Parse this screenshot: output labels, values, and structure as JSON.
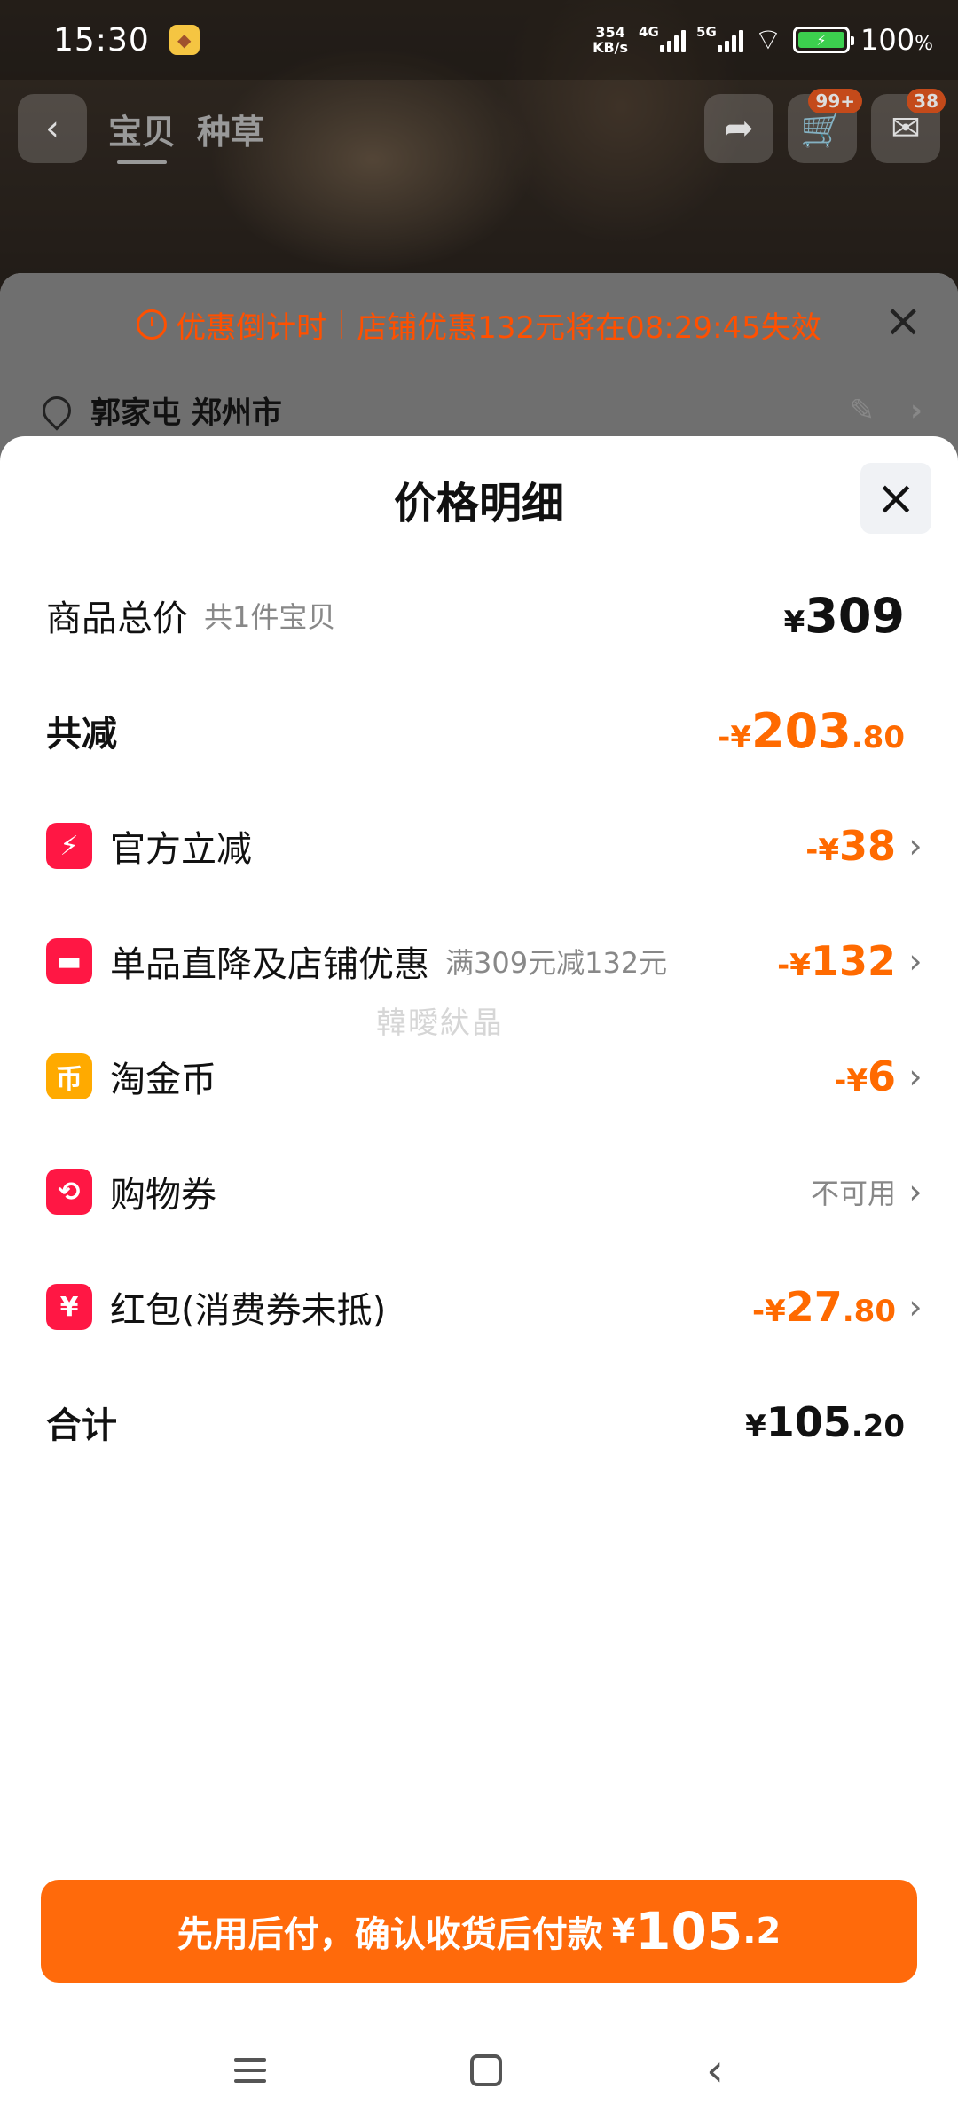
{
  "status_bar": {
    "time": "15:30",
    "net_speed_value": "354",
    "net_speed_unit": "KB/s",
    "signal_1_label": "4G",
    "signal_2_label": "5G",
    "battery_percent": "100",
    "battery_unit": "%"
  },
  "top_nav": {
    "tab_1": "宝贝",
    "tab_2": "种草",
    "cart_badge": "99+",
    "msg_badge": "38"
  },
  "underlying_page": {
    "countdown_label": "优惠倒计时",
    "countdown_text": "店铺优惠132元将在08:29:45失效",
    "address": "郭家屯 郑州市"
  },
  "sheet": {
    "title": "价格明细",
    "rows": [
      {
        "label": "商品总价",
        "sub": "共1件宝贝",
        "currency": "¥",
        "int": "309",
        "dec": ""
      },
      {
        "label": "共减",
        "sign": "-",
        "currency": "¥",
        "int": "203",
        "dec": ".80"
      },
      {
        "label": "官方立减",
        "icon": "lightning-icon",
        "sign": "-",
        "currency": "¥",
        "int": "38",
        "dec": ""
      },
      {
        "label": "单品直降及店铺优惠",
        "sub": "满309元减132元",
        "icon": "store-icon",
        "sign": "-",
        "currency": "¥",
        "int": "132",
        "dec": ""
      },
      {
        "label": "淘金币",
        "icon": "coin-icon",
        "sign": "-",
        "currency": "¥",
        "int": "6",
        "dec": ""
      },
      {
        "label": "购物券",
        "icon": "coupon-icon",
        "status": "不可用"
      },
      {
        "label": "红包(消费券未抵)",
        "icon": "red-packet-icon",
        "sign": "-",
        "currency": "¥",
        "int": "27",
        "dec": ".80"
      },
      {
        "label": "合计",
        "currency": "¥",
        "int": "105",
        "dec": ".20"
      }
    ],
    "watermark": "韓曖紎晶"
  },
  "pay_button": {
    "text": "先用后付，确认收货后付款",
    "currency": "¥",
    "int": "105",
    "dec": ".2"
  },
  "colors": {
    "accent_orange": "#ff6a00",
    "button_orange": "#ff6a0b",
    "icon_red": "#ff1744",
    "icon_gold": "#ffaa00"
  }
}
